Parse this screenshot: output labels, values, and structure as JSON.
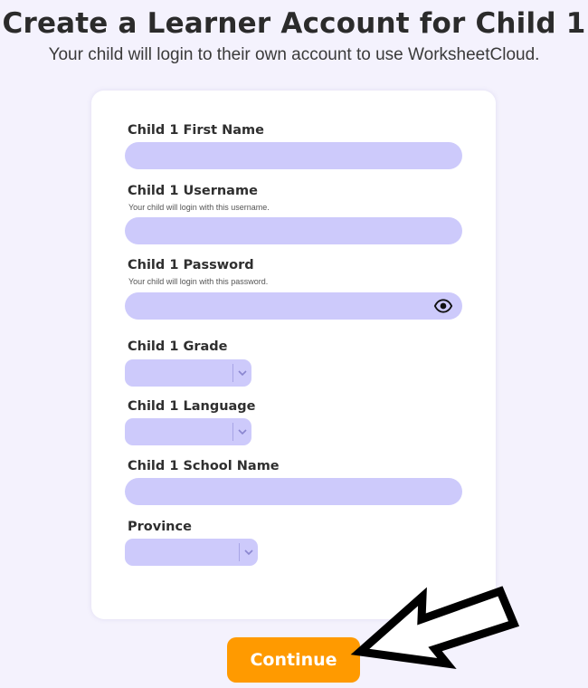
{
  "header": {
    "title": "Create a Learner Account for Child 1",
    "subtitle": "Your child will login to their own account to use WorksheetCloud."
  },
  "form": {
    "first_name": {
      "label": "Child 1 First Name",
      "value": ""
    },
    "username": {
      "label": "Child 1 Username",
      "hint": "Your child will login with this username.",
      "value": ""
    },
    "password": {
      "label": "Child 1 Password",
      "hint": "Your child will login with this password.",
      "value": "",
      "toggle_icon": "eye-icon"
    },
    "grade": {
      "label": "Child 1 Grade",
      "selected": ""
    },
    "language": {
      "label": "Child 1 Language",
      "selected": ""
    },
    "school_name": {
      "label": "Child 1 School Name",
      "value": ""
    },
    "province": {
      "label": "Province",
      "selected": ""
    }
  },
  "actions": {
    "continue_label": "Continue"
  },
  "colors": {
    "background": "#f4f2fd",
    "field": "#cdcafb",
    "button": "#ff9a00",
    "annotation_arrow": "#000000"
  }
}
